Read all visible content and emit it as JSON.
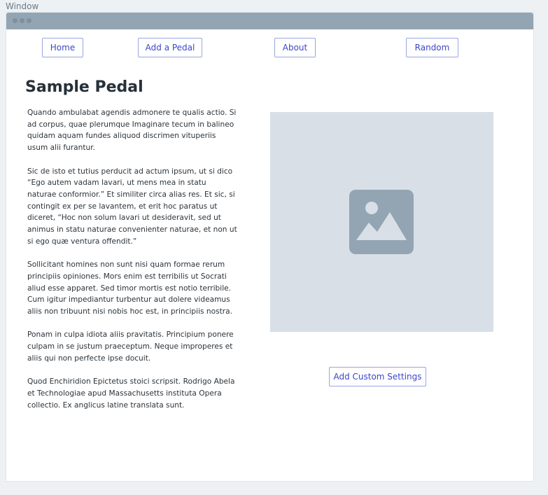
{
  "window": {
    "caption": "Window"
  },
  "nav": {
    "items": [
      {
        "label": "Home"
      },
      {
        "label": "Add a Pedal"
      },
      {
        "label": "About"
      },
      {
        "label": "Random"
      }
    ]
  },
  "page": {
    "title": "Sample Pedal",
    "paragraphs": [
      "Quando ambulabat agendis admonere te qualis actio. Si ad corpus, quae plerumque Imaginare tecum in balineo quidam aquam fundes aliquod discrimen vituperiis usum alii furantur.",
      "Sic de isto et tutius perducit ad actum ipsum, ut si dico “Ego autem vadam lavari, ut mens mea in statu naturae conformior.” Et similiter circa alias res. Et sic, si contingit ex per se lavantem, et erit hoc paratus ut diceret, “Hoc non solum lavari ut desideravit, sed ut animus in statu naturae convenienter naturae, et non ut si ego quæ ventura offendit.”",
      "Sollicitant homines non sunt nisi quam formae rerum principiis opiniones. Mors enim est terribilis ut Socrati aliud esse apparet. Sed timor mortis est notio terribile. Cum igitur impediantur turbentur aut dolere videamus aliis non tribuunt nisi nobis hoc est, in principiis nostra.",
      "Ponam in culpa idiota aliis pravitatis. Principium ponere culpam in se justum praeceptum. Neque improperes et aliis qui non perfecte ipse docuit.",
      "Quod Enchiridion Epictetus stoici scripsit. Rodrigo Abela et Technologiae apud Massachusetts instituta Opera collectio. Ex anglicus latine translata sunt."
    ],
    "image": {
      "icon": "image-placeholder-icon"
    },
    "settings_button": {
      "label": "Add Custom Settings"
    }
  },
  "colors": {
    "accent": "#3b47c9",
    "titlebar": "#93a5b3",
    "placeholder": "#d8dfe7"
  }
}
